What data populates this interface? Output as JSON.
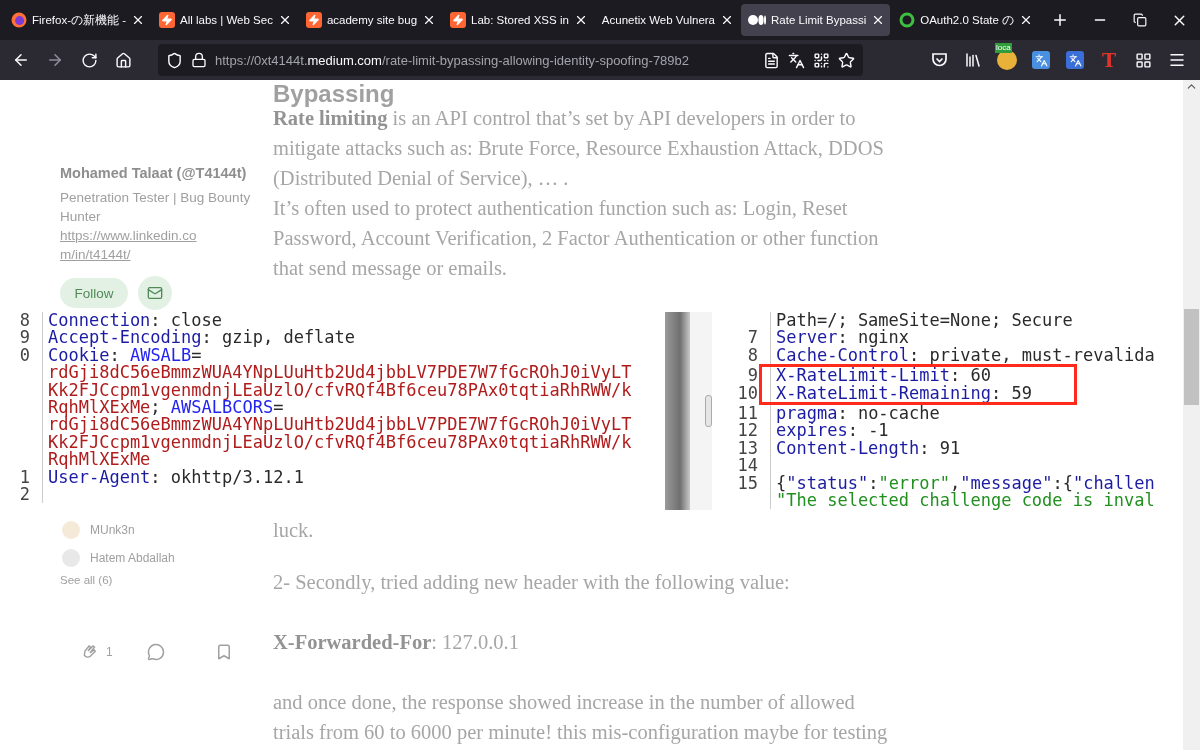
{
  "tabs": [
    {
      "title": "Firefox-の新機能 -",
      "kind": "firefox",
      "selected": false
    },
    {
      "title": "All labs | Web Sec",
      "kind": "lightning",
      "selected": false
    },
    {
      "title": "academy site bug",
      "kind": "lightning",
      "selected": false
    },
    {
      "title": "Lab: Stored XSS in",
      "kind": "lightning",
      "selected": false
    },
    {
      "title": "Acunetix Web Vulnera",
      "kind": "plain",
      "selected": false
    },
    {
      "title": "Rate Limit Bypassi",
      "kind": "medium",
      "selected": true
    },
    {
      "title": "OAuth2.0 State の",
      "kind": "oauth",
      "selected": false
    }
  ],
  "nav_buttons": [
    {
      "kind": "back",
      "disabled": false
    },
    {
      "kind": "forward",
      "disabled": true
    },
    {
      "kind": "reload",
      "disabled": false
    },
    {
      "kind": "home",
      "disabled": false
    }
  ],
  "address": {
    "prefix": "https://0xt4144t.",
    "domain": "medium.com",
    "path": "/rate-limit-bypassing-allowing-identity-spoofing-789b2"
  },
  "toolbar_icons": [
    {
      "kind": "pocket"
    },
    {
      "kind": "library"
    },
    {
      "kind": "badge-ext",
      "badge": "loca"
    },
    {
      "kind": "translate"
    },
    {
      "kind": "translate-ja"
    },
    {
      "kind": "letter-ext",
      "glyph": "T"
    },
    {
      "kind": "extensions"
    },
    {
      "kind": "menu"
    }
  ],
  "sidebar": {
    "author": "Mohamed Talaat (@T4144t)",
    "bio": "Penetration Tester | Bug Bounty Hunter",
    "link": "https://www.linkedin.com/in/t4144t/",
    "follow": "Follow",
    "followers": [
      {
        "name": "MUnk3n"
      },
      {
        "name": "Hatem Abdallah"
      }
    ],
    "see_all": "See all (6)",
    "claps": "1"
  },
  "article": {
    "heading": "Bypassing",
    "paragraphs": [
      "**Rate limiting** is an API control that’s set by API developers in order to mitigate attacks such as: Brute Force, Resource Exhaustion Attack, DDOS (Distributed Denial of Service), … .",
      "It’s often used to protect authentication function such as: Login, Reset Password, Account Verification, 2 Factor Authentication or other function that send message or emails."
    ],
    "after": [
      "luck.",
      "2- Secondly, tried adding new header with the following value:",
      "**X-Forwarded-For**: 127.0.0.1",
      "and once done, the response showed increase in the number of allowed trials from 60 to 6000 per minute! this mis-configuration maybe for testing"
    ]
  },
  "image": {
    "left_lines": [
      {
        "num": "8",
        "tokens": [
          {
            "kind": "key",
            "text": "Connection"
          },
          {
            "kind": "plain",
            "text": ": close"
          }
        ]
      },
      {
        "num": "9",
        "tokens": [
          {
            "kind": "key",
            "text": "Accept-Encoding"
          },
          {
            "kind": "plain",
            "text": ": gzip, deflate"
          }
        ]
      },
      {
        "num": "0",
        "tokens": [
          {
            "kind": "key",
            "text": "Cookie"
          },
          {
            "kind": "plain",
            "text": ": "
          },
          {
            "kind": "name",
            "text": "AWSALB"
          },
          {
            "kind": "plain",
            "text": "="
          }
        ]
      },
      {
        "tokens": [
          {
            "kind": "value",
            "text": "rdGji8dC56eBmmzWUA4YNpLUuHtb2Ud4jbbLV7PDE7W7fGcROhJ0iVyLT"
          }
        ]
      },
      {
        "tokens": [
          {
            "kind": "value",
            "text": "Kk2FJCcpm1vgenmdnjLEaUzlO/cfvRQf4Bf6ceu78PAx0tqtiaRhRWW/k"
          }
        ]
      },
      {
        "tokens": [
          {
            "kind": "value",
            "text": "RqhMlXExMe"
          },
          {
            "kind": "plain",
            "text": "; "
          },
          {
            "kind": "name",
            "text": "AWSALBCORS"
          },
          {
            "kind": "plain",
            "text": "="
          }
        ]
      },
      {
        "tokens": [
          {
            "kind": "value",
            "text": "rdGji8dC56eBmmzWUA4YNpLUuHtb2Ud4jbbLV7PDE7W7fGcROhJ0iVyLT"
          }
        ]
      },
      {
        "tokens": [
          {
            "kind": "value",
            "text": "Kk2FJCcpm1vgenmdnjLEaUzlO/cfvRQf4Bf6ceu78PAx0tqtiaRhRWW/k"
          }
        ]
      },
      {
        "tokens": [
          {
            "kind": "value",
            "text": "RqhMlXExMe"
          }
        ]
      },
      {
        "num": "1",
        "tokens": [
          {
            "kind": "key",
            "text": "User-Agent"
          },
          {
            "kind": "plain",
            "text": ": okhttp/3.12.1"
          }
        ]
      },
      {
        "num": "2"
      }
    ],
    "right_lines": [
      {
        "highlighted": false,
        "tokens": [
          {
            "kind": "plain",
            "text": "Path=/; SameSite=None; Secure"
          }
        ]
      },
      {
        "num": "7",
        "highlighted": false,
        "tokens": [
          {
            "kind": "key",
            "text": "Server"
          },
          {
            "kind": "plain",
            "text": ": nginx"
          }
        ]
      },
      {
        "num": "8",
        "highlighted": false,
        "tokens": [
          {
            "kind": "key",
            "text": "Cache-Control"
          },
          {
            "kind": "plain",
            "text": ": private, must-revalida"
          }
        ]
      },
      {
        "num": "9",
        "highlighted": true,
        "tokens": [
          {
            "kind": "key",
            "text": "X-RateLimit-Limit"
          },
          {
            "kind": "plain",
            "text": ": 60"
          }
        ]
      },
      {
        "num": "10",
        "highlighted": true,
        "tokens": [
          {
            "kind": "key",
            "text": "X-RateLimit-Remaining"
          },
          {
            "kind": "plain",
            "text": ": 59"
          }
        ]
      },
      {
        "num": "11",
        "highlighted": false,
        "tokens": [
          {
            "kind": "key",
            "text": "pragma"
          },
          {
            "kind": "plain",
            "text": ": no-cache"
          }
        ]
      },
      {
        "num": "12",
        "highlighted": false,
        "tokens": [
          {
            "kind": "key",
            "text": "expires"
          },
          {
            "kind": "plain",
            "text": ": -1"
          }
        ]
      },
      {
        "num": "13",
        "highlighted": false,
        "tokens": [
          {
            "kind": "key",
            "text": "Content-Length"
          },
          {
            "kind": "plain",
            "text": ": 91"
          }
        ]
      },
      {
        "num": "14",
        "highlighted": false
      },
      {
        "num": "15",
        "highlighted": false,
        "tokens": [
          {
            "kind": "plain",
            "text": "{"
          },
          {
            "kind": "key",
            "text": "\"status\""
          },
          {
            "kind": "plain",
            "text": ":"
          },
          {
            "kind": "string",
            "text": "\"error\""
          },
          {
            "kind": "plain",
            "text": ","
          },
          {
            "kind": "key",
            "text": "\"message\""
          },
          {
            "kind": "plain",
            "text": ":{"
          },
          {
            "kind": "key",
            "text": "\"challen"
          }
        ]
      },
      {
        "highlighted": false,
        "tokens": [
          {
            "kind": "string",
            "text": "\"The selected challenge code is inval"
          }
        ]
      }
    ]
  }
}
